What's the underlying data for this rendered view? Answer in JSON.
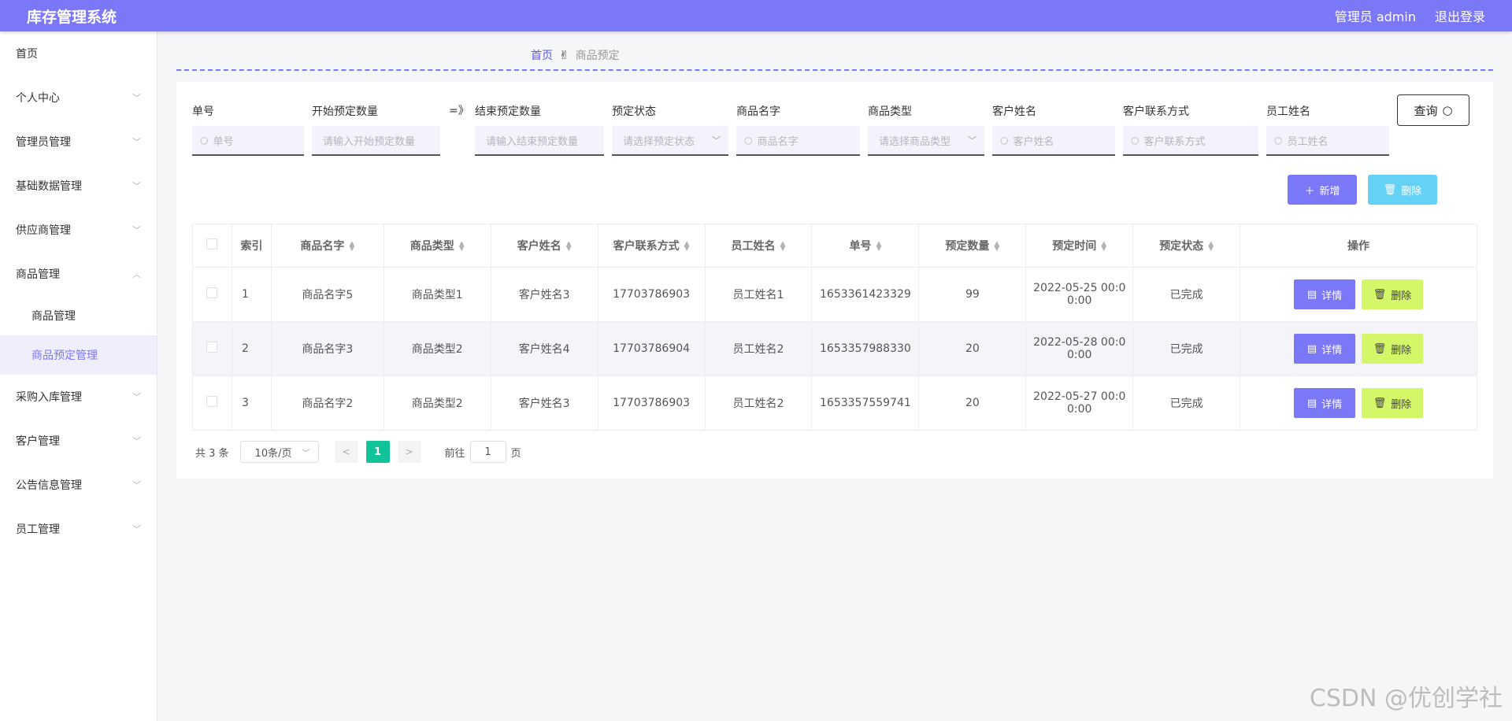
{
  "header": {
    "title": "库存管理系统",
    "user": "管理员 admin",
    "logout": "退出登录"
  },
  "sidebar": {
    "items": [
      {
        "label": "首页"
      },
      {
        "label": "个人中心"
      },
      {
        "label": "管理员管理"
      },
      {
        "label": "基础数据管理"
      },
      {
        "label": "供应商管理"
      },
      {
        "label": "商品管理"
      },
      {
        "label": "商品管理"
      },
      {
        "label": "商品预定管理"
      },
      {
        "label": "采购入库管理"
      },
      {
        "label": "客户管理"
      },
      {
        "label": "公告信息管理"
      },
      {
        "label": "员工管理"
      }
    ]
  },
  "breadcrumb": {
    "home": "首页",
    "sep": "✌",
    "current": "商品预定"
  },
  "filters": {
    "order_no": {
      "label": "单号",
      "placeholder": "单号"
    },
    "start_qty": {
      "label": "开始预定数量",
      "placeholder": "请输入开始预定数量"
    },
    "range_sep": "=》",
    "end_qty": {
      "label": "结束预定数量",
      "placeholder": "请输入结束预定数量"
    },
    "status": {
      "label": "预定状态",
      "placeholder": "请选择预定状态"
    },
    "product_name": {
      "label": "商品名字",
      "placeholder": "商品名字"
    },
    "product_type": {
      "label": "商品类型",
      "placeholder": "请选择商品类型"
    },
    "customer_name": {
      "label": "客户姓名",
      "placeholder": "客户姓名"
    },
    "customer_phone": {
      "label": "客户联系方式",
      "placeholder": "客户联系方式"
    },
    "staff_name": {
      "label": "员工姓名",
      "placeholder": "员工姓名"
    },
    "query_label": "查询"
  },
  "actions": {
    "add_label": "新增",
    "delete_label": "删除"
  },
  "table": {
    "headers": [
      "索引",
      "商品名字",
      "商品类型",
      "客户姓名",
      "客户联系方式",
      "员工姓名",
      "单号",
      "预定数量",
      "预定时间",
      "预定状态",
      "操作"
    ],
    "rows": [
      {
        "index": "1",
        "product": "商品名字5",
        "type": "商品类型1",
        "customer": "客户姓名3",
        "phone": "17703786903",
        "staff": "员工姓名1",
        "order_no": "1653361423329",
        "qty": "99",
        "time1": "2022-05-25 00:0",
        "time2": "0:00",
        "status": "已完成"
      },
      {
        "index": "2",
        "product": "商品名字3",
        "type": "商品类型2",
        "customer": "客户姓名4",
        "phone": "17703786904",
        "staff": "员工姓名2",
        "order_no": "1653357988330",
        "qty": "20",
        "time1": "2022-05-28 00:0",
        "time2": "0:00",
        "status": "已完成"
      },
      {
        "index": "3",
        "product": "商品名字2",
        "type": "商品类型2",
        "customer": "客户姓名3",
        "phone": "17703786903",
        "staff": "员工姓名2",
        "order_no": "1653357559741",
        "qty": "20",
        "time1": "2022-05-27 00:0",
        "time2": "0:00",
        "status": "已完成"
      }
    ],
    "detail_label": "详情",
    "delete_label": "删除"
  },
  "pagination": {
    "total": "共 3 条",
    "page_size": "10条/页",
    "current": "1",
    "goto_label": "前往",
    "goto_value": "1",
    "page_unit": "页"
  },
  "watermark": "CSDN @优创学社"
}
